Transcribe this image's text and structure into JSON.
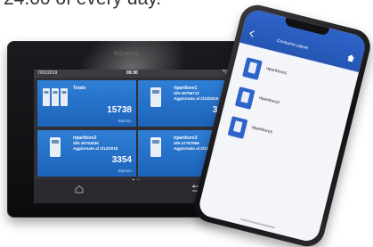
{
  "caption": "24.00 of every day.",
  "tablet": {
    "brand": "MONNU",
    "status": {
      "date": "7/02/2019",
      "time": "09:30"
    },
    "tiles": [
      {
        "title": "Totale",
        "serial": "",
        "updated": "",
        "value": "15738",
        "history_label": "Storico›"
      },
      {
        "title": "ripartitore1",
        "serial": "S/N 45756712",
        "updated": "Aggiornato al 2/12/2018",
        "value": "3450",
        "history_label": "Storico›"
      },
      {
        "title": "ripartitore2",
        "serial": "S/N 45752636",
        "updated": "Aggiornato al 2/12/2018",
        "value": "3354",
        "history_label": "Storico›"
      },
      {
        "title": "ripartitore3",
        "serial": "S/N 47767966",
        "updated": "Aggiornato al 2/12/2018",
        "value": "3210",
        "history_label": "Storico›"
      }
    ],
    "colors": {
      "tile": "#2f7fd6",
      "frame": "#111111"
    }
  },
  "phone": {
    "header_title": "Consumo calore",
    "items": [
      {
        "name": "ripartitore1",
        "sub": ""
      },
      {
        "name": "ripartitore2",
        "sub": ""
      },
      {
        "name": "ripartitore3",
        "sub": ""
      }
    ],
    "colors": {
      "header": "#2e63c9"
    }
  }
}
